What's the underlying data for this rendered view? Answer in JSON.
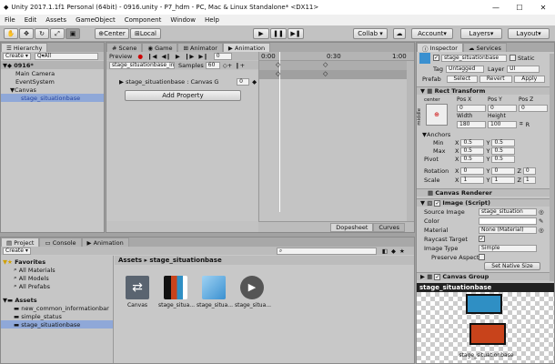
{
  "window": {
    "title": "Unity 2017.1.1f1 Personal (64bit) - 0916.unity - P7_hdm - PC, Mac & Linux Standalone* <DX11>",
    "min": "—",
    "max": "☐",
    "close": "✕"
  },
  "menu": [
    "File",
    "Edit",
    "Assets",
    "GameObject",
    "Component",
    "Window",
    "Help"
  ],
  "toolbar": {
    "center": "Center",
    "local": "Local",
    "collab": "Collab ▾",
    "account": "Account",
    "layers": "Layers",
    "layout": "Layout"
  },
  "hierarchy": {
    "tab": "Hierarchy",
    "create": "Create ▾",
    "search_placeholder": "Q▾All",
    "scene": "0916*",
    "items": [
      "Main Camera",
      "EventSystem",
      "Canvas",
      "stage_situationbase"
    ]
  },
  "scene_tabs": [
    "Scene",
    "Game",
    "Animator",
    "Animation"
  ],
  "animation": {
    "preview": "Preview",
    "clip": "stage_situationbase_in",
    "samples_label": "Samples",
    "samples": "60",
    "frame": "0",
    "ticks": [
      "0:00",
      "0:30",
      "1:00"
    ],
    "property": "stage_situationbase : Canvas G",
    "property_value": "0",
    "add_property": "Add Property",
    "dopesheet": "Dopesheet",
    "curves": "Curves"
  },
  "project": {
    "tabs": [
      "Project",
      "Console",
      "Animation"
    ],
    "create": "Create ▾",
    "breadcrumb": "Assets ▸ stage_situationbase",
    "favorites": "Favorites",
    "fav_items": [
      "All Materials",
      "All Models",
      "All Prefabs"
    ],
    "assets": "Assets",
    "asset_items": [
      "new_common_informationbar",
      "simple_status",
      "stage_situationbase"
    ],
    "files": [
      "Canvas",
      "stage_situa...",
      "stage_situa...",
      "stage_situa..."
    ]
  },
  "inspector": {
    "tabs": [
      "Inspector",
      "Services"
    ],
    "name": "stage_situationbase",
    "static": "Static",
    "tag_label": "Tag",
    "tag": "Untagged",
    "layer_label": "Layer",
    "layer": "UI",
    "prefab_label": "Prefab",
    "prefab_btns": [
      "Select",
      "Revert",
      "Apply"
    ],
    "rect": {
      "title": "Rect Transform",
      "center": "center",
      "middle": "middle",
      "cols": [
        "Pos X",
        "Pos Y",
        "Pos Z"
      ],
      "pos": [
        "0",
        "0",
        "0"
      ],
      "wh_labels": [
        "Width",
        "Height"
      ],
      "wh": [
        "180",
        "100"
      ]
    },
    "anchors": {
      "title": "Anchors",
      "min": "Min",
      "max": "Max",
      "pivot": "Pivot",
      "min_v": [
        "0.5",
        "0.5"
      ],
      "max_v": [
        "0.5",
        "0.5"
      ],
      "pivot_v": [
        "0.5",
        "0.5"
      ]
    },
    "rotation": {
      "label": "Rotation",
      "v": [
        "0",
        "0",
        "0"
      ]
    },
    "scale": {
      "label": "Scale",
      "v": [
        "1",
        "1",
        "1"
      ]
    },
    "canvas_renderer": "Canvas Renderer",
    "image": {
      "title": "Image (Script)",
      "source_label": "Source Image",
      "source": "stage_situation",
      "color_label": "Color",
      "material_label": "Material",
      "material": "None (Material)",
      "raycast_label": "Raycast Target",
      "type_label": "Image Type",
      "type": "Simple",
      "preserve_label": "Preserve Aspect",
      "native": "Set Native Size"
    },
    "canvas_group": "Canvas Group",
    "preview_title": "stage_situationbase",
    "preview_caption": "stage_situationbase"
  },
  "colors": {
    "blue": "#2f8fc4",
    "red": "#c8431b",
    "selection": "#8fa8d8"
  }
}
